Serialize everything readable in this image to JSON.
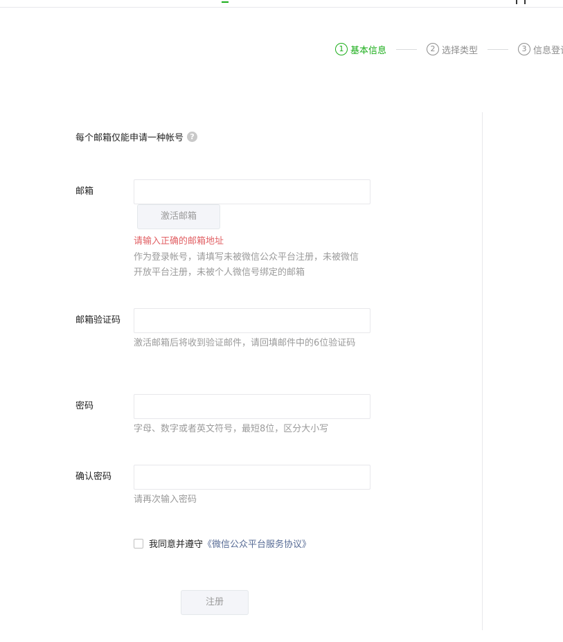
{
  "steps": [
    {
      "num": "1",
      "label": "基本信息"
    },
    {
      "num": "2",
      "label": "选择类型"
    },
    {
      "num": "3",
      "label": "信息登记"
    }
  ],
  "notice": {
    "text": "每个邮箱仅能申请一种帐号",
    "help_icon": "?"
  },
  "form": {
    "email": {
      "label": "邮箱",
      "value": "",
      "activate_button": "激活邮箱",
      "error": "请输入正确的邮箱地址",
      "tip": "作为登录帐号，请填写未被微信公众平台注册，未被微信开放平台注册，未被个人微信号绑定的邮箱"
    },
    "code": {
      "label": "邮箱验证码",
      "value": "",
      "tip": "激活邮箱后将收到验证邮件，请回填邮件中的6位验证码"
    },
    "password": {
      "label": "密码",
      "value": "",
      "tip": "字母、数字或者英文符号，最短8位，区分大小写"
    },
    "confirm": {
      "label": "确认密码",
      "value": "",
      "tip": "请再次输入密码"
    },
    "agree": {
      "text": "我同意并遵守",
      "link": "《微信公众平台服务协议》"
    },
    "submit": "注册"
  },
  "colors": {
    "accent": "#1aad19",
    "error": "#e15f63",
    "link": "#576b95"
  }
}
